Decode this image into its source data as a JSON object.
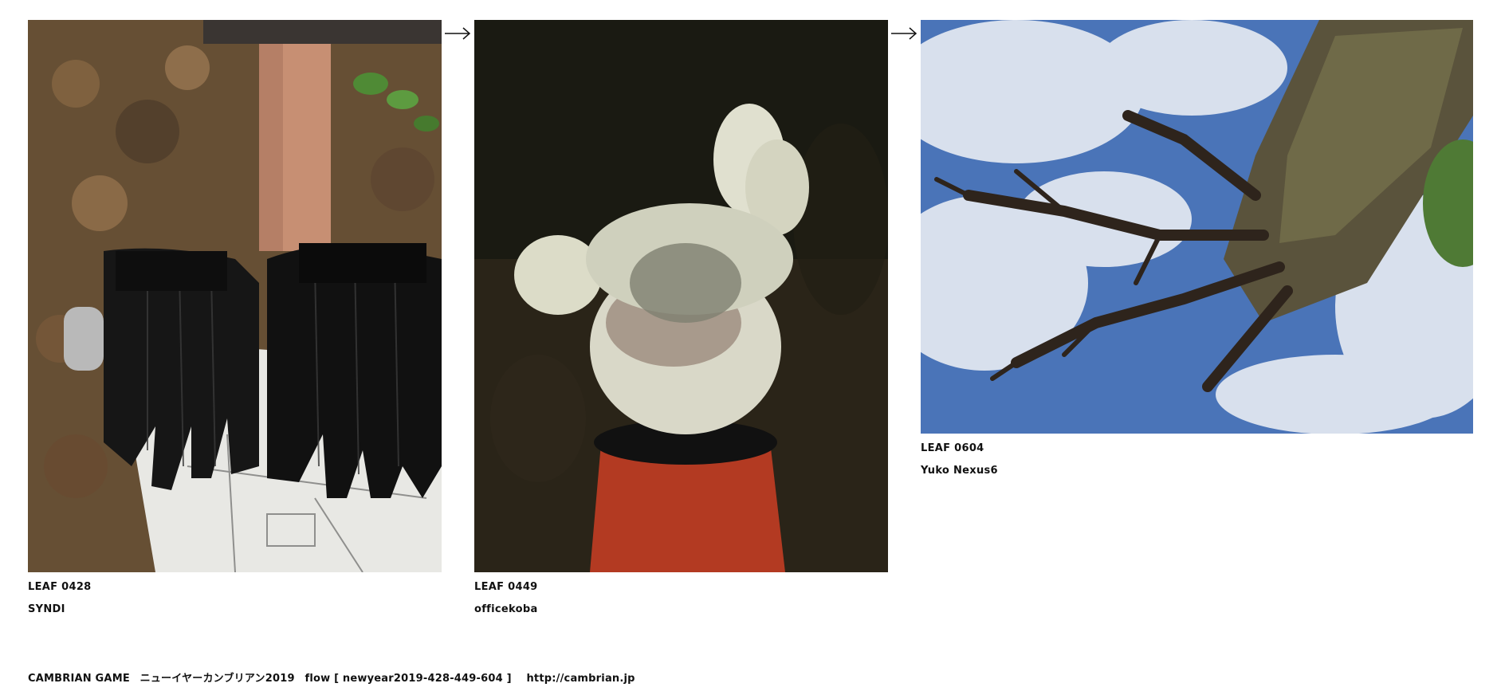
{
  "leaves": [
    {
      "image_name": "black-gloves-photo",
      "leaf_id": "LEAF 0428",
      "author": "SYNDI"
    },
    {
      "image_name": "stuffed-rabbit-on-cone-photo",
      "leaf_id": "LEAF 0449",
      "author": "officekoba"
    },
    {
      "image_name": "tree-and-sky-photo",
      "leaf_id": "LEAF 0604",
      "author": "Yuko Nexus6"
    }
  ],
  "arrows": [
    "arrow-icon",
    "arrow-icon"
  ],
  "footer": {
    "game": "CAMBRIAN GAME",
    "title_jp": "ニューイヤーカンブリアン2019",
    "flow": "flow [ newyear2019-428-449-604 ]",
    "url": "http://cambrian.jp"
  },
  "colors": {
    "background": "#ffffff",
    "text": "#111111"
  }
}
